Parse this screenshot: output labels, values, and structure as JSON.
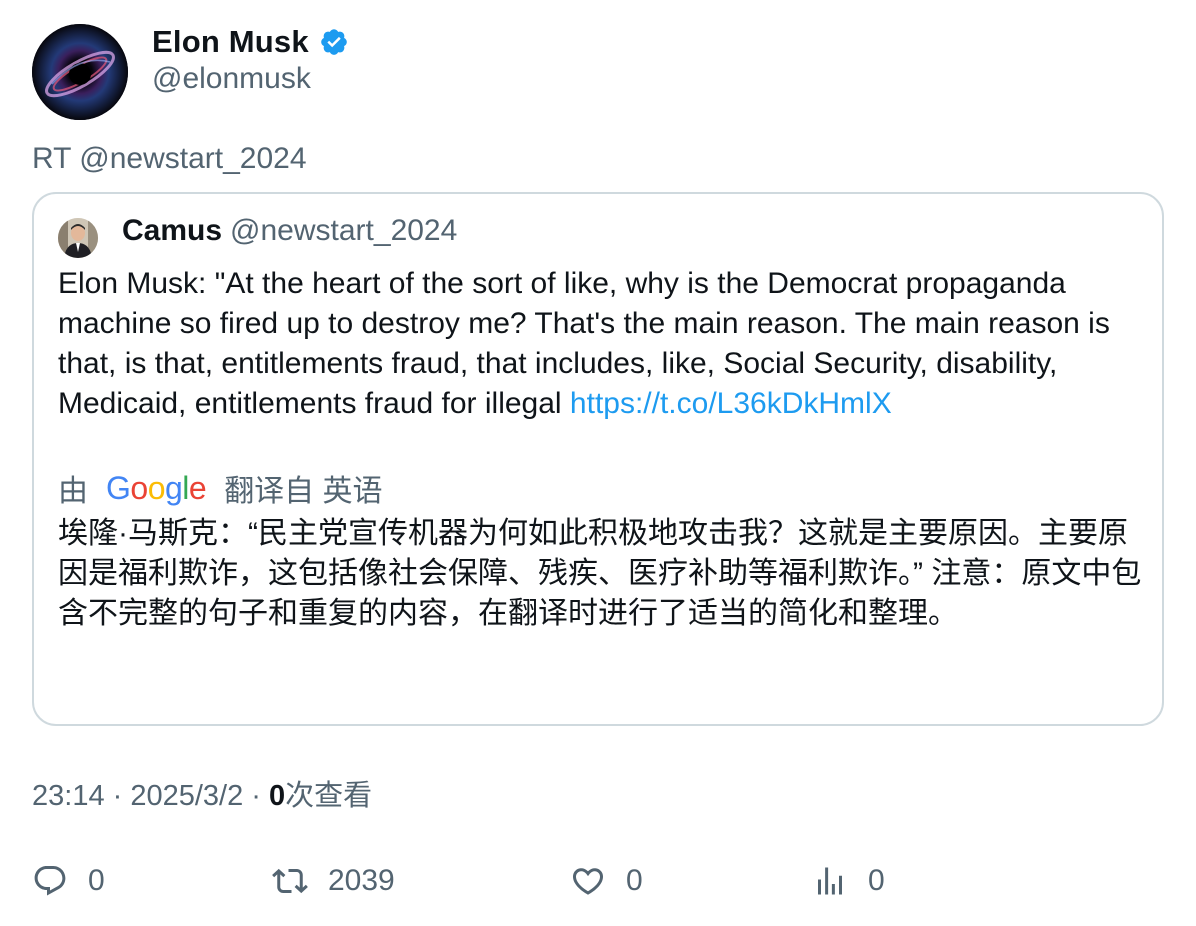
{
  "author": {
    "display_name": "Elon Musk",
    "handle": "@elonmusk",
    "verified": true
  },
  "retweet_line": "RT @newstart_2024",
  "quoted": {
    "display_name": "Camus",
    "handle": "@newstart_2024",
    "text": "Elon Musk: \"At the heart of the sort of like, why is the Democrat propaganda machine so fired up to destroy me? That's the main reason. The main reason is that, is that, entitlements fraud, that includes, like, Social Security, disability, Medicaid, entitlements fraud for illegal ",
    "link": "https://t.co/L36kDkHmlX",
    "translate": {
      "by_label": "由",
      "from_label": "翻译自 英语",
      "text": "埃隆·马斯克：“民主党宣传机器为何如此积极地攻击我？这就是主要原因。主要原因是福利欺诈，这包括像社会保障、残疾、医疗补助等福利欺诈。” 注意：原文中包含不完整的句子和重复的内容，在翻译时进行了适当的简化和整理。"
    }
  },
  "meta": {
    "time_date": "23:14 · 2025/3/2 · ",
    "views_count": "0",
    "views_label": "次查看"
  },
  "actions": {
    "reply_count": "0",
    "retweet_count": "2039",
    "like_count": "0",
    "views_count": "0"
  },
  "colors": {
    "accent": "#1d9bf0",
    "secondary_text": "#536471",
    "border": "#cfd9de"
  },
  "icons": [
    "verified-badge-icon",
    "reply-icon",
    "retweet-icon",
    "like-icon",
    "views-icon",
    "google-logo"
  ]
}
